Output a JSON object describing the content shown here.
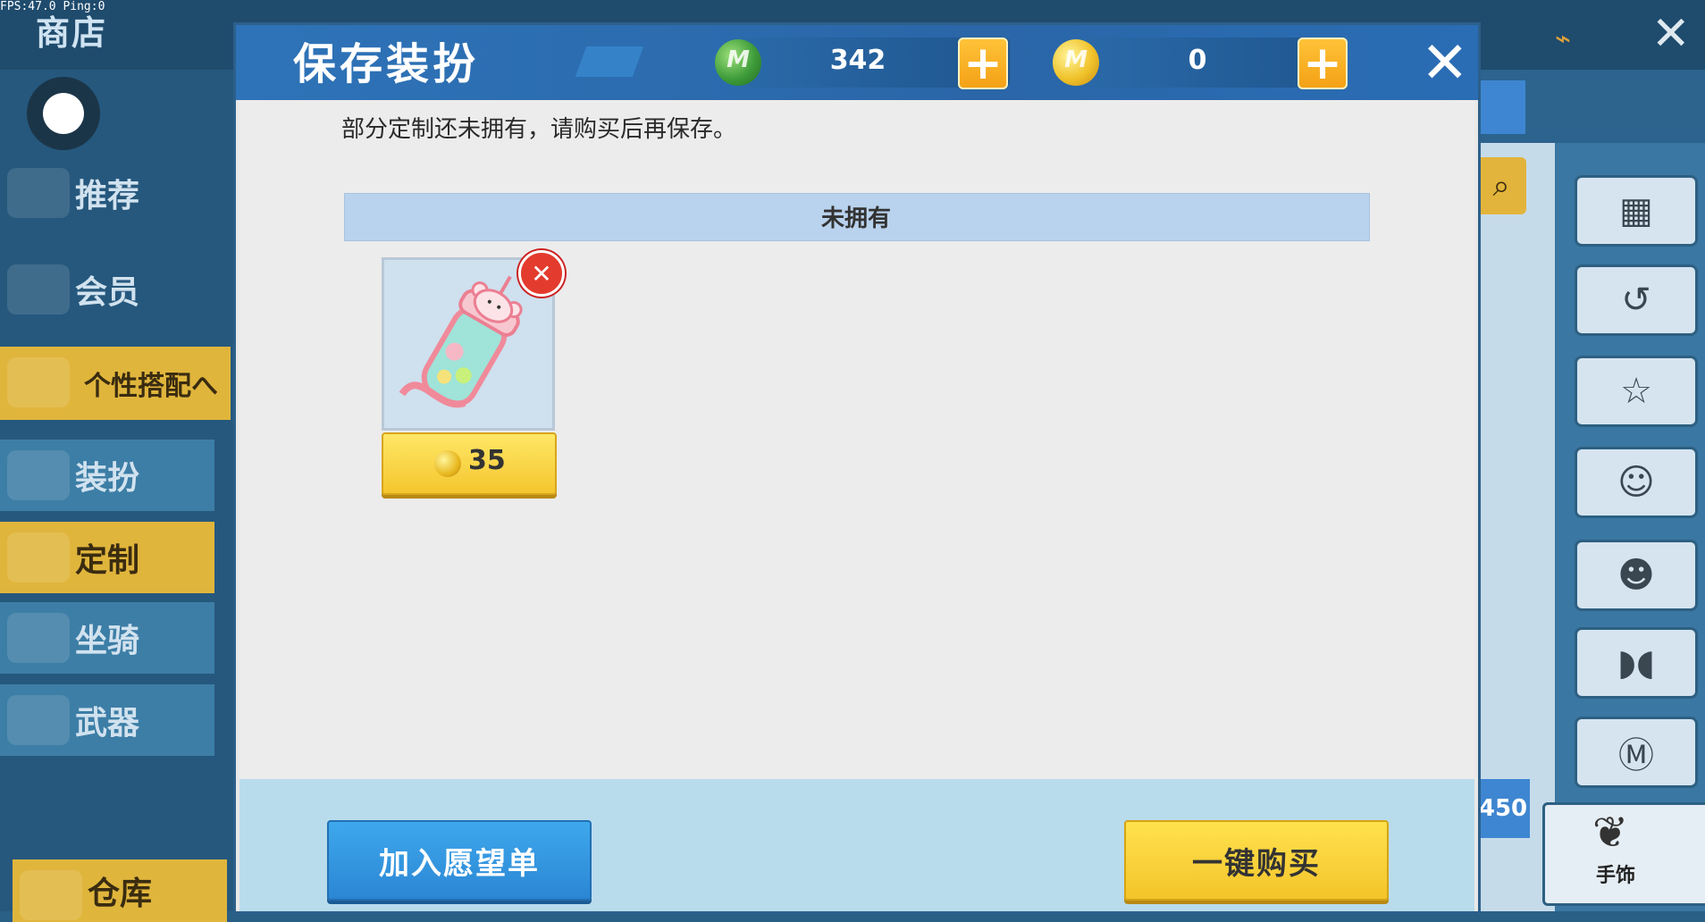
{
  "status": {
    "fps_text": "FPS:47.0  Ping:0"
  },
  "shop": {
    "title": "商店",
    "sidebar": [
      {
        "label": "推荐",
        "style": "plain"
      },
      {
        "label": "会员",
        "style": "plain"
      },
      {
        "label": "个性搭配へ",
        "style": "yellow"
      },
      {
        "label": "装扮",
        "style": "blue"
      },
      {
        "label": "定制",
        "style": "yellow"
      },
      {
        "label": "坐骑",
        "style": "blue"
      },
      {
        "label": "武器",
        "style": "blue"
      },
      {
        "label": "仓库",
        "style": "yellow"
      }
    ],
    "right_price": "450",
    "accessory_label": "手饰"
  },
  "modal": {
    "title": "保存装扮",
    "currency_green": "342",
    "currency_gold": "0",
    "notice": "部分定制还未拥有，请购买后再保存。",
    "section_title": "未拥有",
    "item": {
      "price": "35",
      "icon": "bottle-item-icon"
    },
    "wishlist_label": "加入愿望单",
    "buy_label": "一键购买"
  },
  "colors": {
    "header_blue": "#2e73b8",
    "accent_yellow": "#f4c62e",
    "accent_blue": "#2b86d4",
    "close_red": "#e33b2e"
  }
}
